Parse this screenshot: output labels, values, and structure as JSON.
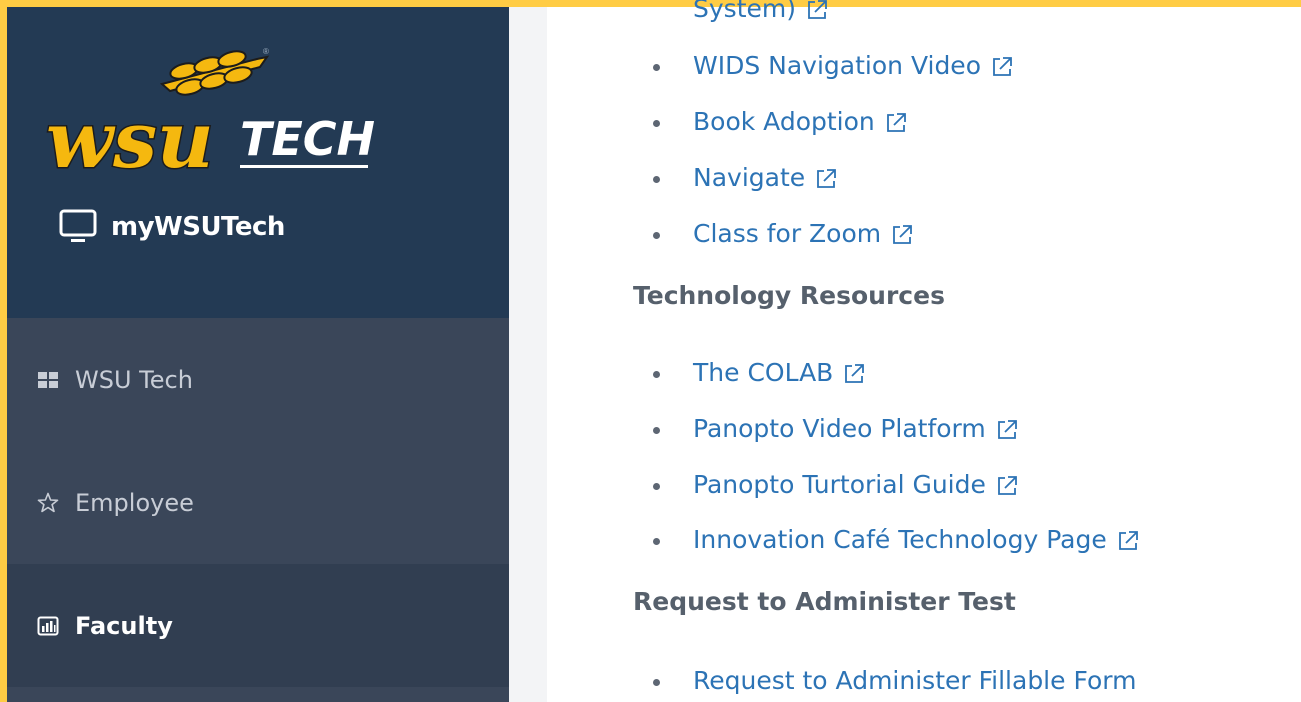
{
  "sidebar": {
    "logo_wordmark": "WSU TECH",
    "logo_trademark": "®",
    "app_title": "myWSUTech",
    "nav": [
      {
        "label": "WSU Tech",
        "icon": "grid-icon",
        "active": false
      },
      {
        "label": "Employee",
        "icon": "star-icon",
        "active": false
      },
      {
        "label": "Faculty",
        "icon": "chart-icon",
        "active": true
      }
    ]
  },
  "content": {
    "partial_top_item": "System)",
    "group1_links": [
      "WIDS Navigation Video",
      "Book Adoption",
      "Navigate",
      "Class for Zoom"
    ],
    "section_technology": "Technology Resources",
    "technology_links": [
      "The COLAB",
      "Panopto Video Platform",
      "Panopto Turtorial Guide",
      "Innovation Café Technology Page"
    ],
    "section_test": "Request to Administer Test",
    "test_links": [
      "Request to Administer Fillable Form"
    ]
  },
  "colors": {
    "sidebar_brand_bg": "#233a54",
    "sidebar_bg": "#3a4659",
    "link": "#2c73b5",
    "heading": "#56606c",
    "outline": "#ffcc44",
    "logo_gold": "#f5b80f"
  }
}
